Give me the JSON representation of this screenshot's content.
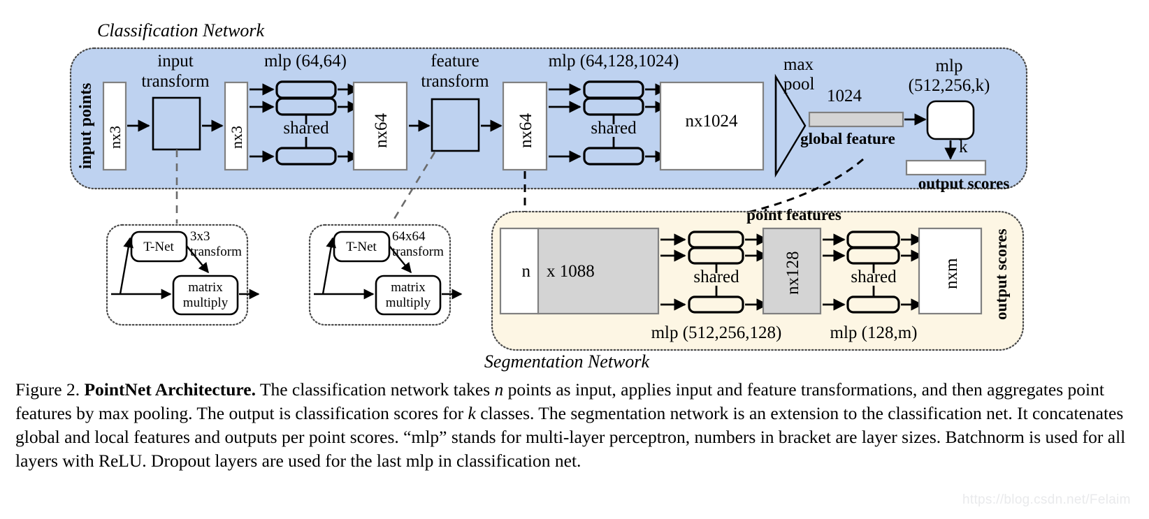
{
  "figure": {
    "number": "Figure 2.",
    "bold_title": "PointNet Architecture.",
    "caption_rest_1": " The classification network takes ",
    "caption_n": "n",
    "caption_rest_2": " points as input, applies input and feature transformations, and then aggregates point features by max pooling. The output is classification scores for ",
    "caption_k": "k",
    "caption_rest_3": " classes. The segmentation network is an extension to the classification net. It concatenates global and local features and outputs per point scores. “mlp” stands for multi-layer perceptron, numbers in bracket are layer sizes. Batchnorm is used for all layers with ReLU. Dropout layers are used for the last mlp in classification net.",
    "watermark": "https://blog.csdn.net/Felaim"
  },
  "classification_network": {
    "title": "Classification Network",
    "panel_color": "#bed2f0",
    "input_points_label": "input points",
    "blocks": {
      "input_nx3": "nx3",
      "input_transform_title_line1": "input",
      "input_transform_title_line2": "transform",
      "transformed_nx3": "nx3",
      "mlp1_title": "mlp (64,64)",
      "mlp1_shared": "shared",
      "nx64_a": "nx64",
      "feature_transform_title_line1": "feature",
      "feature_transform_title_line2": "transform",
      "nx64_b": "nx64",
      "mlp2_title": "mlp (64,128,1024)",
      "mlp2_shared": "shared",
      "nx1024": "nx1024",
      "max_pool_line1": "max",
      "max_pool_line2": "pool",
      "global_feature_size": "1024",
      "global_feature_label": "global feature",
      "mlp3_title_line1": "mlp",
      "mlp3_title_line2": "(512,256,k)",
      "k_label": "k",
      "output_scores_label": "output scores"
    }
  },
  "tnet_boxes": [
    {
      "id": "input-transform-detail",
      "tnet_label": "T-Net",
      "transform_line1": "3x3",
      "transform_line2": "transform",
      "matrix_line1": "matrix",
      "matrix_line2": "multiply"
    },
    {
      "id": "feature-transform-detail",
      "tnet_label": "T-Net",
      "transform_line1": "64x64",
      "transform_line2": "transform",
      "matrix_line1": "matrix",
      "matrix_line2": "multiply"
    }
  ],
  "segmentation_network": {
    "title": "Segmentation Network",
    "panel_color": "#fdf6e4",
    "point_features_label": "point features",
    "blocks": {
      "concat_n": "n",
      "concat_rest": "x 1088",
      "mlp4_title": "mlp (512,256,128)",
      "mlp4_shared": "shared",
      "nx128": "nx128",
      "mlp5_title": "mlp (128,m)",
      "mlp5_shared": "shared",
      "nxm": "nxm",
      "output_scores_label": "output scores"
    }
  }
}
